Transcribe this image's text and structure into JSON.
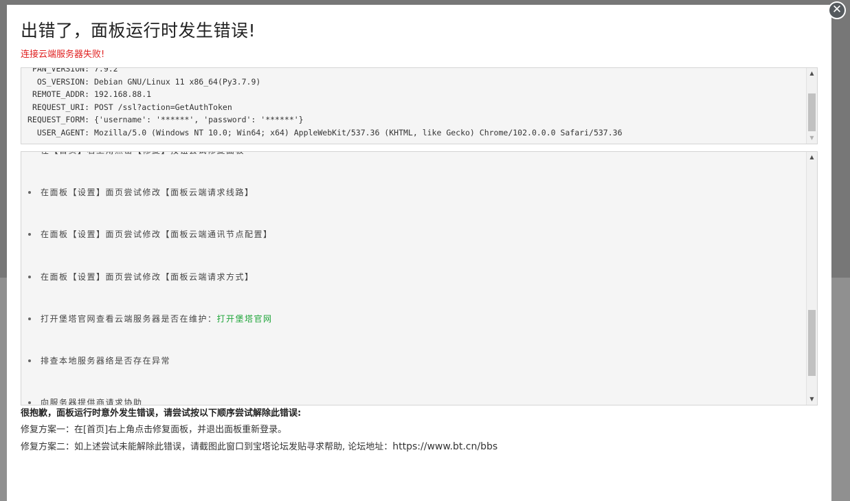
{
  "modal": {
    "close_icon_glyph": "✕",
    "title": "出错了，面板运行时发生错误!",
    "subtitle": "连接云端服务器失败!"
  },
  "env_info": [
    {
      "key": "PAN_VERSION",
      "label": "PAN_VERSION:",
      "value": "7.9.2"
    },
    {
      "key": "OS_VERSION",
      "label": "OS_VERSION:",
      "value": "Debian GNU/Linux 11 x86_64(Py3.7.9)"
    },
    {
      "key": "REMOTE_ADDR",
      "label": "REMOTE_ADDR:",
      "value": "192.168.88.1"
    },
    {
      "key": "REQUEST_URI",
      "label": "REQUEST_URI:",
      "value": "POST /ssl?action=GetAuthToken"
    },
    {
      "key": "REQUEST_FORM",
      "label": "REQUEST_FORM:",
      "value": "{'username': '******', 'password': '******'}"
    },
    {
      "key": "USER_AGENT",
      "label": "USER_AGENT:",
      "value": "Mozilla/5.0 (Windows NT 10.0; Win64; x64) AppleWebKit/537.36 (KHTML, like Gecko) Chrome/102.0.0.0 Safari/537.36"
    }
  ],
  "steps": [
    {
      "text": "在【首页】右上角点击【修复】按钮尝试修复面板"
    },
    {
      "text": "在面板【设置】面页尝试修改【面板云端请求线路】"
    },
    {
      "text": "在面板【设置】面页尝试修改【面板云端通讯节点配置】"
    },
    {
      "text": "在面板【设置】面页尝试修改【面板云端请求方式】"
    },
    {
      "text": "打开堡塔官网查看云端服务器是否在维护：",
      "link": "打开堡塔官网"
    },
    {
      "text": "排查本地服务器络是否存在异常"
    },
    {
      "text": "向服务器提供商请求协助"
    }
  ],
  "footer": {
    "title": "很抱歉，面板运行时意外发生错误，请尝试按以下顺序尝试解除此错误:",
    "fix1": "修复方案一：在[首页]右上角点击修复面板，并退出面板重新登录。",
    "fix2_prefix": "修复方案二：如上述尝试未能解除此错误，请截图此窗口到宝塔论坛发贴寻求帮助, 论坛地址：",
    "fix2_url": "https://www.bt.cn/bbs"
  },
  "colors": {
    "title": "#222222",
    "subtitle": "#e02020",
    "link": "#20a53a",
    "overlay": "#777777",
    "box_bg": "#f5f5f5"
  }
}
